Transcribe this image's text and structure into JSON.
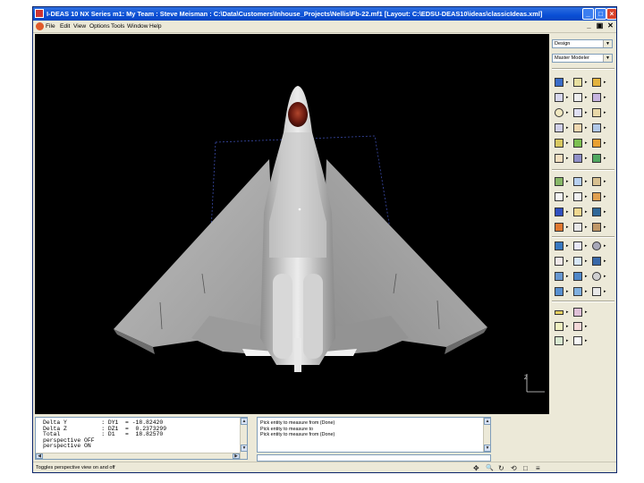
{
  "window": {
    "title": "I-DEAS 10 NX Series m1:    My Team : Steve Meisman : C:\\Data\\Customers\\Inhouse_Projects\\Nellis\\Fb-22.mf1    [Layout: C:\\EDSU-DEAS10\\ideas\\classicIdeas.xml]",
    "minimize_glyph": "_",
    "maximize_glyph": "□",
    "close_glyph": "×"
  },
  "menu": {
    "items": [
      "File",
      "Edit",
      "View",
      "Options",
      "Tools",
      "Window",
      "Help"
    ],
    "mdi_minimize": "_",
    "mdi_restore": "▣",
    "mdi_close": "✕"
  },
  "panel": {
    "task": "Design",
    "application": "Master Modeler",
    "combo_arrow": "▼"
  },
  "output_log": {
    "lines": [
      "Delta Y          : DY1  = -18.82420",
      "Delta Z          : DZ1  =  0.2373299",
      "Total            : D1   =  18.82570",
      "perspective OFF",
      "perspective ON"
    ]
  },
  "prompt_log": {
    "lines": [
      "Pick entity to measure from (Done)",
      "Pick entity to measure to",
      "Pick entity to measure from (Done)"
    ]
  },
  "scroll": {
    "up": "▲",
    "down": "▼",
    "left": "◀",
    "right": "▶"
  },
  "status": {
    "text": "Toggles perspective view on and off",
    "icons": [
      "pan-icon",
      "zoom-icon",
      "rotate-icon",
      "dynamic-navigator-icon",
      "box-icon",
      "display-icon"
    ],
    "glyphs": [
      "✥",
      "🔍",
      "↻",
      "⟲",
      "□",
      "≡"
    ]
  },
  "triad_label": "Z",
  "colors": {
    "titlebar": "#0a4fd6",
    "viewport": "#000000",
    "aircraft": "#b8b8b8",
    "canopy": "#6a1a10"
  }
}
